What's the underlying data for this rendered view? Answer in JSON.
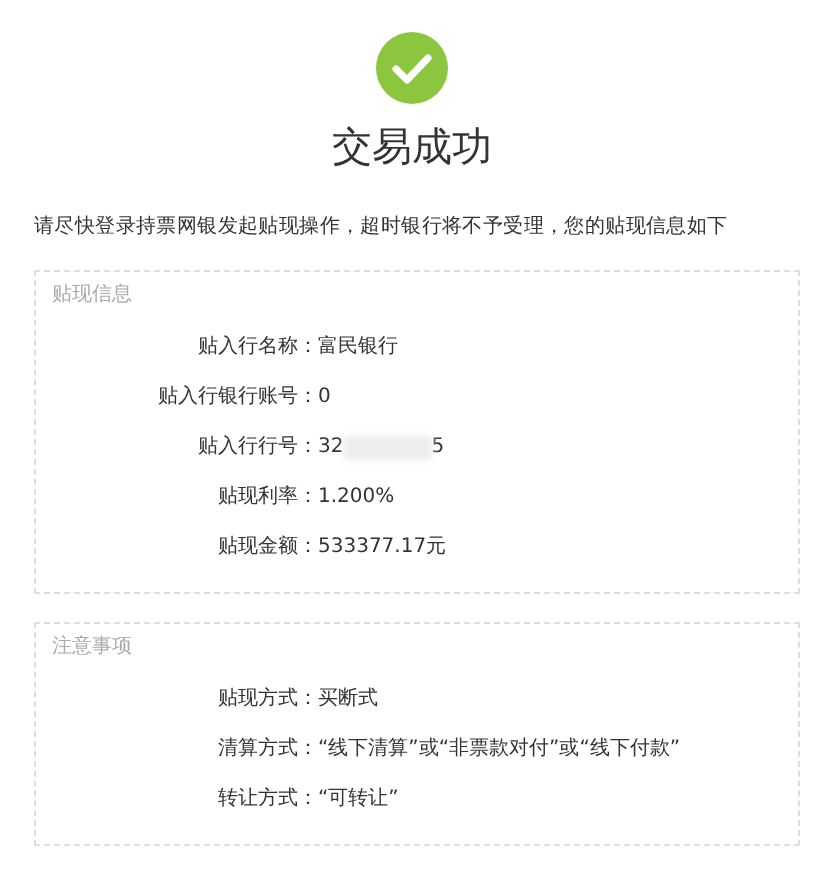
{
  "status": {
    "title": "交易成功"
  },
  "notice": "请尽快登录持票网银发起贴现操作，超时银行将不予受理，您的贴现信息如下",
  "sections": [
    {
      "title": "贴现信息",
      "rows": [
        {
          "label": "贴入行名称：",
          "value": "富民银行"
        },
        {
          "label": "贴入行银行账号：",
          "value": "0"
        },
        {
          "label": "贴入行行号：",
          "value": "32",
          "redacted": true,
          "value_end": "5"
        },
        {
          "label": "贴现利率：",
          "value": "1.200%"
        },
        {
          "label": "贴现金额：",
          "value": "533377.17元"
        }
      ]
    },
    {
      "title": "注意事项",
      "rows": [
        {
          "label": "贴现方式：",
          "value": "买断式"
        },
        {
          "label": "清算方式：",
          "value": "“线下清算”或“非票款对付”或“线下付款”"
        },
        {
          "label": "转让方式：",
          "value": "“可转让”"
        }
      ]
    }
  ]
}
